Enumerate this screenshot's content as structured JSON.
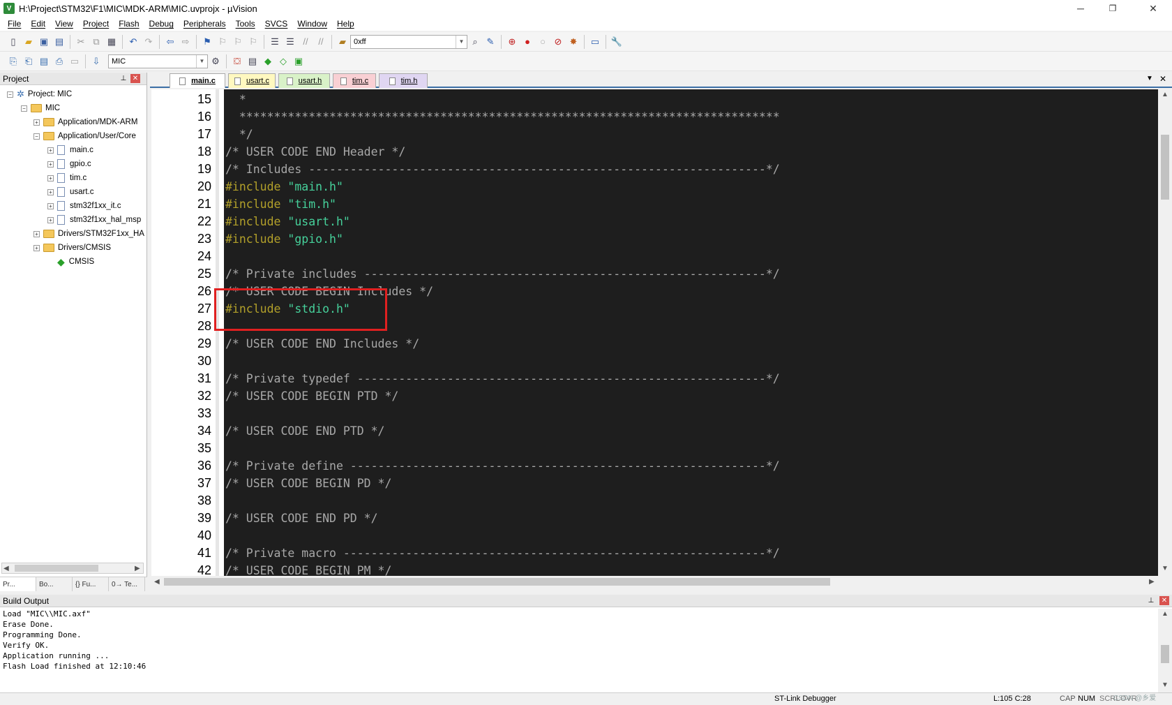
{
  "window": {
    "title": "H:\\Project\\STM32\\F1\\MIC\\MDK-ARM\\MIC.uvprojx - µVision",
    "app_icon_letter": "V",
    "minimize": "─",
    "restore": "❐",
    "close": "✕"
  },
  "menu": [
    "File",
    "Edit",
    "View",
    "Project",
    "Flash",
    "Debug",
    "Peripherals",
    "Tools",
    "SVCS",
    "Window",
    "Help"
  ],
  "toolbar1": {
    "find_value": "0xff"
  },
  "toolbar2": {
    "target_value": "MIC"
  },
  "project_panel": {
    "title": "Project",
    "pin": "📌",
    "close": "✕",
    "tree": [
      {
        "label": "Project: MIC",
        "kind": "project",
        "toggle": "⊟"
      },
      {
        "label": "MIC",
        "kind": "target",
        "toggle": "⊟"
      },
      {
        "label": "Application/MDK-ARM",
        "kind": "folder",
        "toggle": "⊞"
      },
      {
        "label": "Application/User/Core",
        "kind": "folder",
        "toggle": "⊟"
      },
      {
        "label": "main.c",
        "kind": "file",
        "toggle": "⊞"
      },
      {
        "label": "gpio.c",
        "kind": "file",
        "toggle": "⊞"
      },
      {
        "label": "tim.c",
        "kind": "file",
        "toggle": "⊞"
      },
      {
        "label": "usart.c",
        "kind": "file",
        "toggle": "⊞"
      },
      {
        "label": "stm32f1xx_it.c",
        "kind": "file",
        "toggle": "⊞"
      },
      {
        "label": "stm32f1xx_hal_msp",
        "kind": "file",
        "toggle": "⊞"
      },
      {
        "label": "Drivers/STM32F1xx_HA",
        "kind": "folder",
        "toggle": "⊞"
      },
      {
        "label": "Drivers/CMSIS",
        "kind": "folder",
        "toggle": "⊞"
      },
      {
        "label": "CMSIS",
        "kind": "cmsis",
        "toggle": ""
      }
    ],
    "tabs": [
      "Pr...",
      "Bo...",
      "{} Fu...",
      "0→ Te..."
    ]
  },
  "editor_tabs": [
    {
      "label": "main.c",
      "color": "#ffffff"
    },
    {
      "label": "usart.c",
      "color": "#fff8c0"
    },
    {
      "label": "usart.h",
      "color": "#d9f2c8"
    },
    {
      "label": "tim.c",
      "color": "#f9d0d4"
    },
    {
      "label": "tim.h",
      "color": "#e0d6f2"
    }
  ],
  "editor": {
    "lines": [
      {
        "n": "15",
        "parts": [
          {
            "t": "  *",
            "c": "cm"
          }
        ]
      },
      {
        "n": "16",
        "parts": [
          {
            "t": "  ******************************************************************************",
            "c": "cm"
          }
        ]
      },
      {
        "n": "17",
        "parts": [
          {
            "t": "  */",
            "c": "cm"
          }
        ]
      },
      {
        "n": "18",
        "parts": [
          {
            "t": "/* USER CODE END Header */",
            "c": "cm"
          }
        ]
      },
      {
        "n": "19",
        "parts": [
          {
            "t": "/* Includes ------------------------------------------------------------------*/",
            "c": "cm"
          }
        ]
      },
      {
        "n": "20",
        "parts": [
          {
            "t": "#include ",
            "c": "pp"
          },
          {
            "t": "\"main.h\"",
            "c": "str"
          }
        ]
      },
      {
        "n": "21",
        "parts": [
          {
            "t": "#include ",
            "c": "pp"
          },
          {
            "t": "\"tim.h\"",
            "c": "str"
          }
        ]
      },
      {
        "n": "22",
        "parts": [
          {
            "t": "#include ",
            "c": "pp"
          },
          {
            "t": "\"usart.h\"",
            "c": "str"
          }
        ]
      },
      {
        "n": "23",
        "parts": [
          {
            "t": "#include ",
            "c": "pp"
          },
          {
            "t": "\"gpio.h\"",
            "c": "str"
          }
        ]
      },
      {
        "n": "24",
        "parts": []
      },
      {
        "n": "25",
        "parts": [
          {
            "t": "/* Private includes ----------------------------------------------------------*/",
            "c": "cm"
          }
        ]
      },
      {
        "n": "26",
        "parts": [
          {
            "t": "/* USER CODE BEGIN Includes */",
            "c": "cm"
          }
        ]
      },
      {
        "n": "27",
        "parts": [
          {
            "t": "#include ",
            "c": "pp"
          },
          {
            "t": "\"stdio.h\"",
            "c": "str"
          }
        ]
      },
      {
        "n": "28",
        "parts": []
      },
      {
        "n": "29",
        "parts": [
          {
            "t": "/* USER CODE END Includes */",
            "c": "cm"
          }
        ]
      },
      {
        "n": "30",
        "parts": []
      },
      {
        "n": "31",
        "parts": [
          {
            "t": "/* Private typedef -----------------------------------------------------------*/",
            "c": "cm"
          }
        ]
      },
      {
        "n": "32",
        "parts": [
          {
            "t": "/* USER CODE BEGIN PTD */",
            "c": "cm"
          }
        ]
      },
      {
        "n": "33",
        "parts": []
      },
      {
        "n": "34",
        "parts": [
          {
            "t": "/* USER CODE END PTD */",
            "c": "cm"
          }
        ]
      },
      {
        "n": "35",
        "parts": []
      },
      {
        "n": "36",
        "parts": [
          {
            "t": "/* Private define ------------------------------------------------------------*/",
            "c": "cm"
          }
        ]
      },
      {
        "n": "37",
        "parts": [
          {
            "t": "/* USER CODE BEGIN PD */",
            "c": "cm"
          }
        ]
      },
      {
        "n": "38",
        "parts": []
      },
      {
        "n": "39",
        "parts": [
          {
            "t": "/* USER CODE END PD */",
            "c": "cm"
          }
        ]
      },
      {
        "n": "40",
        "parts": []
      },
      {
        "n": "41",
        "parts": [
          {
            "t": "/* Private macro -------------------------------------------------------------*/",
            "c": "cm"
          }
        ]
      },
      {
        "n": "42",
        "parts": [
          {
            "t": "/* USER CODE BEGIN PM */",
            "c": "cm"
          }
        ]
      }
    ],
    "highlighted_line": "27",
    "highlight_color": "#e02020"
  },
  "build_output": {
    "title": "Build Output",
    "lines": [
      "Load \"MIC\\\\MIC.axf\"",
      "Erase Done.",
      "Programming Done.",
      "Verify OK.",
      "Application running ...",
      "Flash Load finished at 12:10:46"
    ]
  },
  "status": {
    "debugger": "ST-Link Debugger",
    "position": "L:105 C:28",
    "cap": "CAP",
    "num": "NUM",
    "scrl": "SCRL",
    "ovr": "OVR",
    "watermark": "CSDN @乡爱"
  },
  "colors": {
    "editor_bg": "#1e1e1e",
    "comment": "#a8a8a8",
    "preprocessor": "#b2a02a",
    "string": "#46d19b"
  }
}
